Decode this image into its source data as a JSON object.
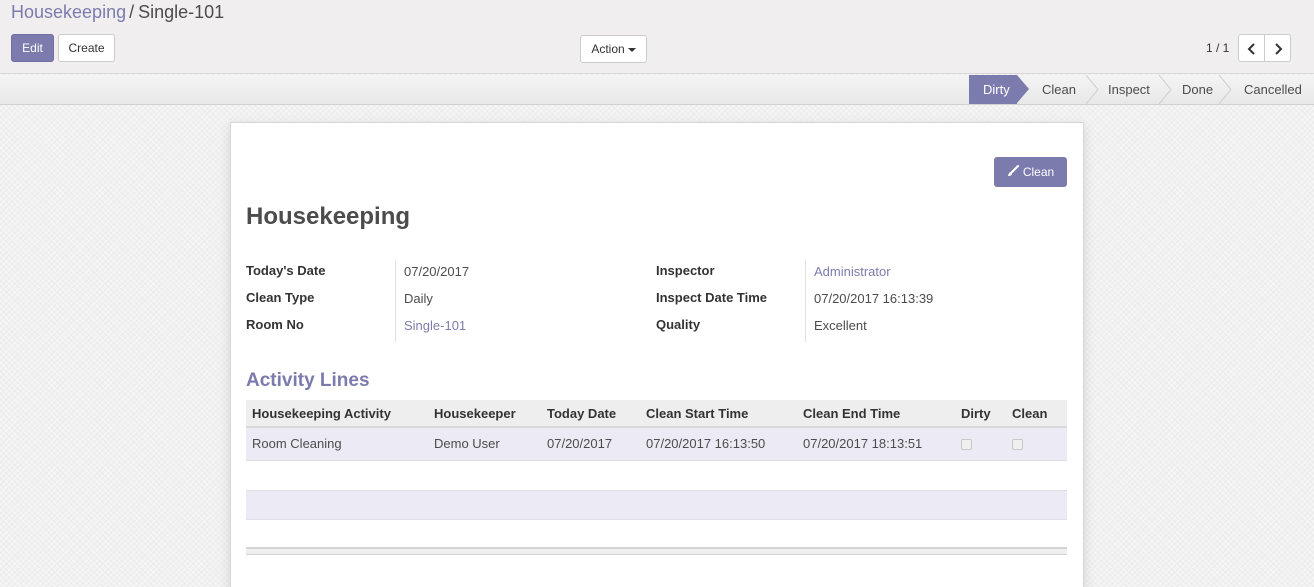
{
  "breadcrumb": {
    "parent": "Housekeeping",
    "separator": "/",
    "current": "Single-101"
  },
  "toolbar": {
    "edit_label": "Edit",
    "create_label": "Create",
    "action_label": "Action"
  },
  "pager": {
    "value": "1 / 1",
    "prev_icon": "chevron-left-icon",
    "next_icon": "chevron-right-icon"
  },
  "statusbar": {
    "stages": [
      "Dirty",
      "Clean",
      "Inspect",
      "Done",
      "Cancelled"
    ],
    "active": "Dirty"
  },
  "header_button": {
    "label": "Clean",
    "icon": "brush-icon"
  },
  "form": {
    "title": "Housekeeping",
    "left_fields": [
      {
        "label": "Today's Date",
        "value": "07/20/2017"
      },
      {
        "label": "Clean Type",
        "value": "Daily"
      },
      {
        "label": "Room No",
        "value": "Single-101"
      }
    ],
    "right_fields": [
      {
        "label": "Inspector",
        "value": "Administrator"
      },
      {
        "label": "Inspect Date Time",
        "value": "07/20/2017 16:13:39"
      },
      {
        "label": "Quality",
        "value": "Excellent"
      }
    ]
  },
  "activity_lines": {
    "title": "Activity Lines",
    "columns": [
      "Housekeeping Activity",
      "Housekeeper",
      "Today Date",
      "Clean Start Time",
      "Clean End Time",
      "Dirty",
      "Clean"
    ],
    "rows": [
      [
        "Room Cleaning",
        "Demo User",
        "07/20/2017",
        "07/20/2017 16:13:50",
        "07/20/2017 18:13:51"
      ]
    ],
    "row_checks": [
      [
        false,
        false
      ]
    ]
  },
  "colors": {
    "primary": "#7c7bad",
    "row_highlight": "#ecebf5"
  }
}
